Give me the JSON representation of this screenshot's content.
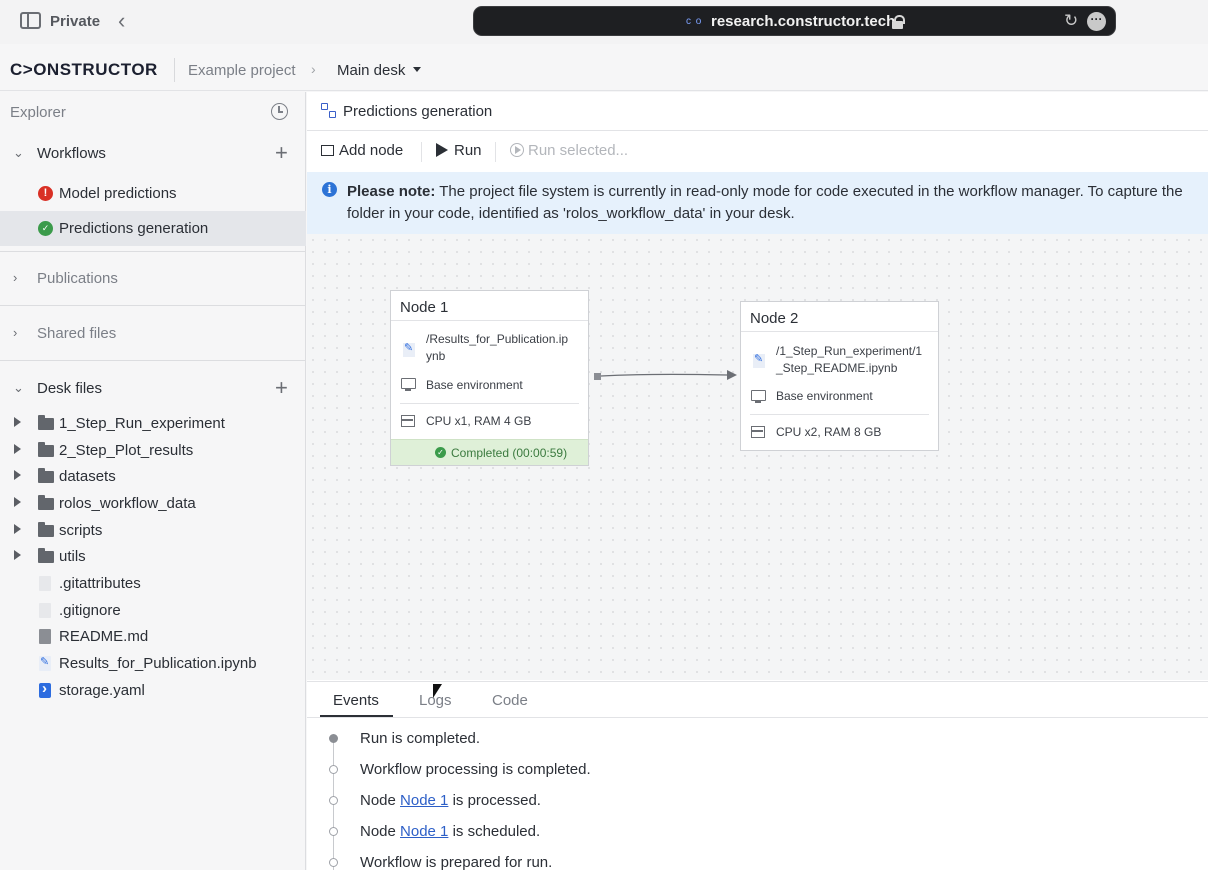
{
  "browser": {
    "profile": "Private",
    "url": "research.constructor.tech"
  },
  "app": {
    "logo": "C>ONSTRUCTOR",
    "project": "Example project",
    "desk": "Main desk"
  },
  "explorer": {
    "title": "Explorer",
    "workflows": {
      "label": "Workflows",
      "items": [
        {
          "label": "Model predictions",
          "status": "error"
        },
        {
          "label": "Predictions generation",
          "status": "ok"
        }
      ]
    },
    "publications_label": "Publications",
    "shared_files_label": "Shared files",
    "desk_files": {
      "label": "Desk files",
      "items": [
        {
          "label": "1_Step_Run_experiment",
          "type": "folder"
        },
        {
          "label": "2_Step_Plot_results",
          "type": "folder"
        },
        {
          "label": "datasets",
          "type": "folder"
        },
        {
          "label": "rolos_workflow_data",
          "type": "folder"
        },
        {
          "label": "scripts",
          "type": "folder"
        },
        {
          "label": "utils",
          "type": "folder"
        },
        {
          "label": ".gitattributes",
          "type": "file"
        },
        {
          "label": ".gitignore",
          "type": "file"
        },
        {
          "label": "README.md",
          "type": "md"
        },
        {
          "label": "Results_for_Publication.ipynb",
          "type": "ipynb"
        },
        {
          "label": "storage.yaml",
          "type": "yaml"
        }
      ]
    }
  },
  "workflow": {
    "title": "Predictions generation",
    "toolbar": {
      "add_node": "Add node",
      "run": "Run",
      "run_selected": "Run selected..."
    },
    "notice": {
      "bold": "Please note:",
      "line1": " The project file system is currently in read-only mode for code executed in the workflow manager. To capture the",
      "line2": "folder in your code, identified as 'rolos_workflow_data' in your desk."
    },
    "nodes": [
      {
        "title": "Node 1",
        "path_line1": "/Results_for_Publication.ip",
        "path_line2": "ynb",
        "environment": "Base environment",
        "resources": "CPU x1, RAM 4 GB",
        "status": "Completed (00:00:59)"
      },
      {
        "title": "Node 2",
        "path_line1": "/1_Step_Run_experiment/1",
        "path_line2": "_Step_README.ipynb",
        "environment": "Base environment",
        "resources": "CPU x2, RAM 8 GB"
      }
    ]
  },
  "bottom_panel": {
    "tabs": [
      "Events",
      "Logs",
      "Code"
    ],
    "active_tab": "Events",
    "events": [
      {
        "pre": "Run is completed.",
        "link": "",
        "post": ""
      },
      {
        "pre": "Workflow processing is completed.",
        "link": "",
        "post": ""
      },
      {
        "pre": "Node ",
        "link": "Node 1",
        "post": " is processed."
      },
      {
        "pre": "Node ",
        "link": "Node 1",
        "post": " is scheduled."
      },
      {
        "pre": "Workflow is prepared for run.",
        "link": "",
        "post": ""
      }
    ]
  },
  "colors": {
    "accent": "#2d5fc7",
    "success": "#3b9b4b",
    "error": "#d93025",
    "notice_bg": "#e6f1fc"
  }
}
